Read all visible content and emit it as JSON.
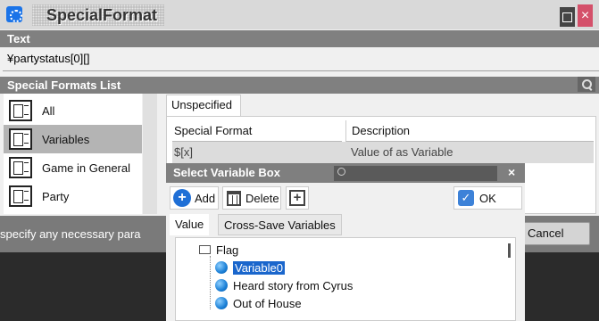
{
  "window": {
    "title": "SpecialFormat"
  },
  "text_section": {
    "header": "Text",
    "value": "¥partystatus[0][]"
  },
  "list_section": {
    "header": "Special Formats List",
    "categories": [
      {
        "label": "All"
      },
      {
        "label": "Variables"
      },
      {
        "label": "Game in General"
      },
      {
        "label": "Party"
      }
    ],
    "selected": "Variables"
  },
  "tab": {
    "label": "Unspecified"
  },
  "table": {
    "columns": [
      "Special Format",
      "Description"
    ],
    "rows": [
      {
        "format": "$[x]",
        "description": "Value of as Variable"
      }
    ]
  },
  "hint_text": "specify any necessary para",
  "cancel_label": "Cancel",
  "popup": {
    "title": "Select Variable Box",
    "add_label": "Add",
    "delete_label": "Delete",
    "ok_label": "OK",
    "tabs": [
      "Value",
      "Cross-Save Variables"
    ],
    "tree": {
      "folder": "Flag",
      "items": [
        "Variable0",
        "Heard story from Cyrus",
        "Out of House"
      ],
      "selected": "Variable0"
    }
  }
}
